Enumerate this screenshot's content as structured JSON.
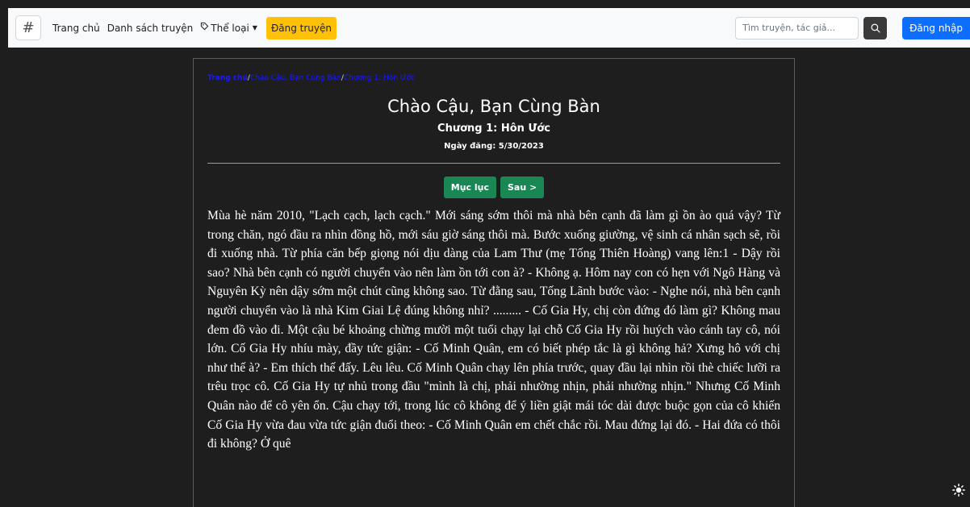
{
  "navbar": {
    "brand": "#",
    "links": {
      "home": "Trang chủ",
      "list": "Danh sách truyện",
      "genres": "Thể loại",
      "post": "Đăng truyện"
    },
    "search_placeholder": "Tìm truyện, tác giả...",
    "login": "Đăng nhập"
  },
  "breadcrumb": {
    "home": "Trang chủ",
    "sep": "/",
    "story": "Chào Cậu, Bạn Cùng Bàn",
    "chapter": "Chương 1: Hôn Ước"
  },
  "story": {
    "title": "Chào Cậu, Bạn Cùng Bàn",
    "chapter_title": "Chương 1: Hôn Ước",
    "date": "Ngày đăng: 5/30/2023"
  },
  "buttons": {
    "toc": "Mục lục",
    "next": "Sau >"
  },
  "content": "Mùa hè năm 2010, \"Lạch cạch, lạch cạch.\" Mới sáng sớm thôi mà nhà bên cạnh đã làm gì ồn ào quá vậy? Từ trong chăn, ngó đầu ra nhìn đồng hồ, mới sáu giờ sáng thôi mà. Bước xuống giường, vệ sinh cá nhân sạch sẽ, rồi đi xuống nhà. Từ phía căn bếp giọng nói dịu dàng của Lam Thư (mẹ Tống Thiên Hoàng) vang lên:1 - Dậy rồi sao? Nhà bên cạnh có người chuyển vào nên làm ồn tới con à? - Không ạ. Hôm nay con có hẹn với Ngô Hàng và Nguyên Kỳ nên dậy sớm một chút cũng không sao. Từ đằng sau, Tống Lãnh bước vào: - Nghe nói, nhà bên cạnh người chuyển vào là nhà Kim Giai Lệ đúng không nhỉ? ......... - Cố Gia Hy, chị còn đứng đó làm gì? Không mau đem đồ vào đi. Một cậu bé khoảng chừng mười một tuổi chạy lại chỗ Cố Gia Hy rồi huých vào cánh tay cô, nói lớn. Cố Gia Hy nhíu mày, đầy tức giận: - Cố Minh Quân, em có biết phép tắc là gì không hả? Xưng hô với chị như thế à? - Em thích thế đấy. Lêu lêu. Cố Minh Quân chạy lên phía trước, quay đầu lại nhìn rồi thè chiếc lưỡi ra trêu trọc cô. Cố Gia Hy tự nhủ trong đầu \"mình là chị, phải nhường nhịn, phải nhường nhịn.\" Nhưng Cố Minh Quân nào để cô yên ổn. Cậu chạy tới, trong lúc cô không để ý liền giật mái tóc dài được buộc gọn của cô khiến Cố Gia Hy vừa đau vừa tức giận đuổi theo: - Cố Minh Quân em chết chắc rồi. Mau đứng lại đó. - Hai đứa có thôi đi không? Ở quê"
}
